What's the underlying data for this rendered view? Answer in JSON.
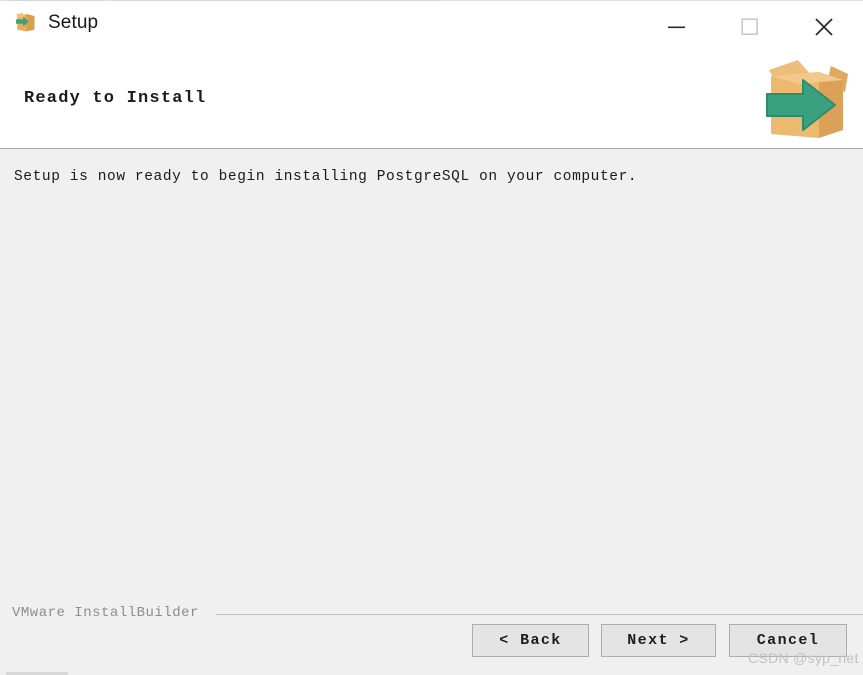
{
  "window": {
    "title": "Setup",
    "app_icon": "install-box-arrow-icon",
    "controls": {
      "minimize_label": "Minimize",
      "maximize_label": "Maximize",
      "close_label": "Close"
    }
  },
  "header": {
    "title": "Ready to Install",
    "art_icon": "open-box-green-arrow-icon"
  },
  "main": {
    "message": "Setup is now ready to begin installing PostgreSQL on your computer."
  },
  "footer": {
    "brand": "VMware InstallBuilder",
    "buttons": {
      "back": "< Back",
      "next": "Next >",
      "cancel": "Cancel"
    }
  },
  "watermark": {
    "text": "CSDN @syp_net"
  },
  "colors": {
    "titlebar_bg": "#ffffff",
    "body_bg": "#f0f0f0",
    "header_border": "#a8a8a8",
    "button_bg": "#e4e4e4",
    "button_border": "#adadad",
    "box_orange": "#e8b05c",
    "box_orange_light": "#f0c077",
    "box_orange_dark": "#d9a04b",
    "arrow_green": "#3aa17e",
    "arrow_green_dark": "#2f8b6b",
    "brand_gray": "#8d8d8d",
    "watermark_gray": "#c2c2c2",
    "title_text": "#17171f"
  }
}
